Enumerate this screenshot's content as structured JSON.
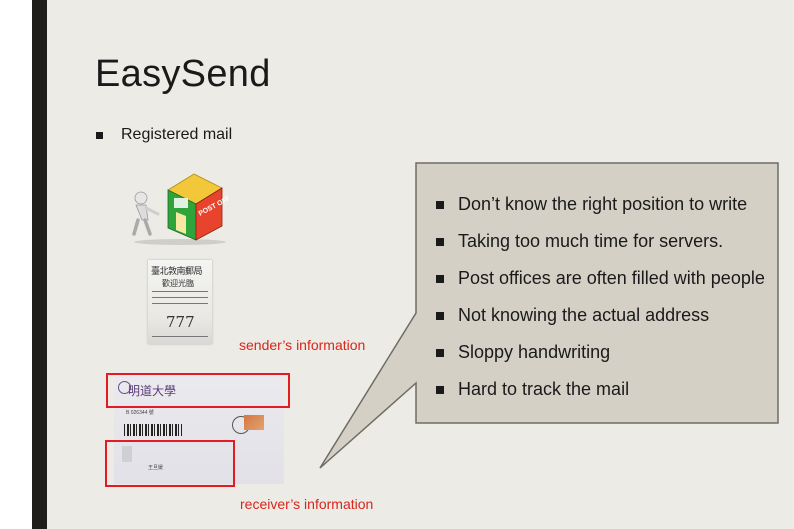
{
  "slide": {
    "title": "EasySend",
    "bullet": "Registered mail"
  },
  "callout": {
    "items": [
      "Don’t know the right position to write",
      "Taking too much time for servers.",
      "Post offices are often filled with people",
      "Not knowing the actual address",
      "Sloppy handwriting",
      "Hard to track the mail"
    ]
  },
  "labels": {
    "sender": "sender’s information",
    "receiver": "receiver’s information"
  },
  "images": {
    "post_office": {
      "sign": "POST OFFICE"
    },
    "ticket": {
      "header": "臺北敦南郵局",
      "greeting": "歡迎光臨",
      "number": "777"
    },
    "envelope": {
      "sender_name": "明道大學",
      "serial": "B 026344 號",
      "receiver_name": "王旦媛"
    }
  },
  "colors": {
    "background": "#ecebe6",
    "callout_fill": "#d4d0c6",
    "accent_red": "#e31c23",
    "label_red": "#d9261c"
  }
}
